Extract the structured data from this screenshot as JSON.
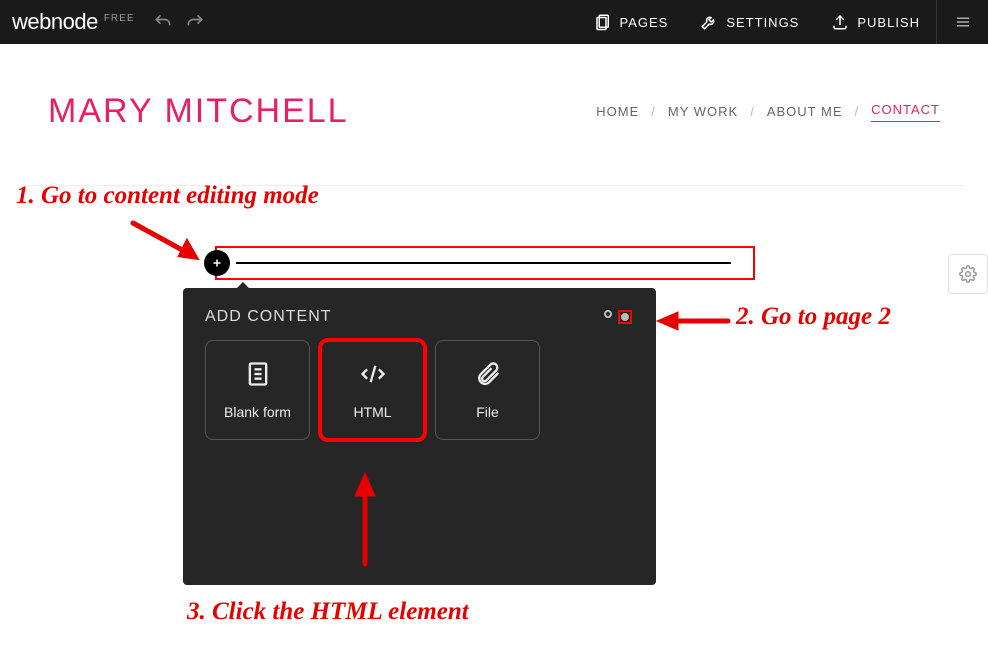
{
  "topbar": {
    "brand": "webnode",
    "plan": "FREE",
    "pages": "PAGES",
    "settings": "SETTINGS",
    "publish": "PUBLISH"
  },
  "site": {
    "title": "MARY MITCHELL",
    "nav": {
      "home": "HOME",
      "work": "MY WORK",
      "about": "ABOUT ME",
      "contact": "CONTACT"
    }
  },
  "panel": {
    "title": "ADD CONTENT",
    "tiles": {
      "blank": "Blank form",
      "html": "HTML",
      "file": "File"
    }
  },
  "annotations": {
    "step1": "1. Go to content editing mode",
    "step2": "2. Go to page 2",
    "step3": "3. Click the HTML element"
  }
}
